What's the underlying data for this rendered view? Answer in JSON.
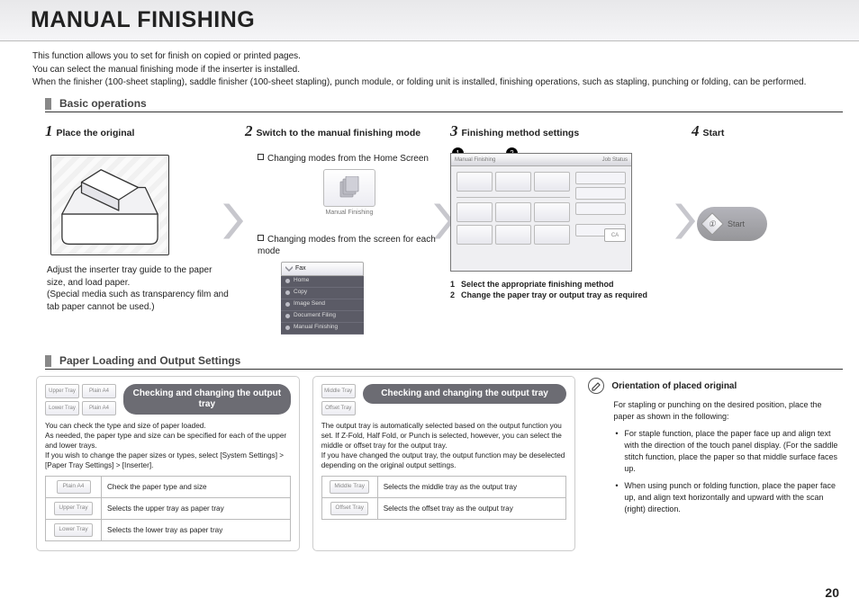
{
  "title": "MANUAL FINISHING",
  "intro": [
    "This function allows you to set for finish on copied or printed pages.",
    "You can select the manual finishing mode if the inserter is installed.",
    "When the finisher (100-sheet stapling), saddle finisher (100-sheet stapling), punch module, or folding unit is installed, finishing operations, such as stapling, punching or folding, can be performed."
  ],
  "sections": {
    "basic_ops": "Basic operations",
    "paper": "Paper Loading and Output Settings"
  },
  "steps": {
    "s1": {
      "num": "1",
      "title": "Place the original",
      "note1": "Adjust the inserter tray guide to the paper size, and load paper.",
      "note2": "(Special media such as transparency film and tab paper cannot be used.)"
    },
    "s2": {
      "num": "2",
      "title": "Switch to the manual finishing mode",
      "b1": "Changing modes from the Home Screen",
      "b2": "Changing modes from the screen for each mode",
      "home_label": "Manual Finishing",
      "mode_top": "Fax",
      "modes": [
        "Home",
        "Copy",
        "Image Send",
        "Document Filing",
        "Manual Finishing"
      ]
    },
    "s3": {
      "num": "3",
      "title": "Finishing method settings",
      "panel_title": "Manual Finishing",
      "job_status": "Job Status",
      "ca": "CA",
      "note1": "Select the appropriate finishing method",
      "note2": "Change the paper tray or output tray as required",
      "callout1": "1",
      "callout2": "2"
    },
    "s4": {
      "num": "4",
      "title": "Start",
      "btn": "Start",
      "glyph": "①"
    }
  },
  "card1": {
    "pill": "Checking and changing the output tray",
    "btns": {
      "upper": "Upper Tray",
      "lower": "Lower Tray",
      "plain": "Plain A4"
    },
    "p1": "You can check the type and size of paper loaded.",
    "p2": "As needed, the paper type and size can be specified for each of the upper and lower trays.",
    "p3": "If you wish to change the paper sizes or types, select [System Settings] > [Paper Tray Settings] > [Inserter].",
    "rows": [
      {
        "icon": "Plain\nA4",
        "text": "Check the paper type and size"
      },
      {
        "icon": "Upper Tray",
        "text": "Selects the upper tray as paper tray"
      },
      {
        "icon": "Lower Tray",
        "text": "Selects the lower tray as paper tray"
      }
    ]
  },
  "card2": {
    "pill": "Checking and changing the output tray",
    "btns": {
      "middle": "Middle Tray",
      "offset": "Offset Tray"
    },
    "p1": "The output tray is automatically selected based on the output function you set. If Z-Fold, Half Fold, or Punch is selected, however, you can select the middle or offset tray for the output tray.",
    "p2": "If you have changed the output tray, the output function may be deselected depending on the original output settings.",
    "rows": [
      {
        "icon": "Middle Tray",
        "text": "Selects the middle tray as the output tray"
      },
      {
        "icon": "Offset Tray",
        "text": "Selects the offset tray as the output tray"
      }
    ]
  },
  "orient": {
    "title": "Orientation of placed original",
    "lead": "For stapling or punching on the desired position, place the paper as shown in the following:",
    "b1": "For staple function, place the paper face up and align text with the direction of the touch panel display. (For the saddle stitch function, place the paper so that middle surface faces up.",
    "b2": "When using punch or folding function, place the paper face up, and align text horizontally and upward with the scan (right) direction."
  },
  "page_number": "20"
}
